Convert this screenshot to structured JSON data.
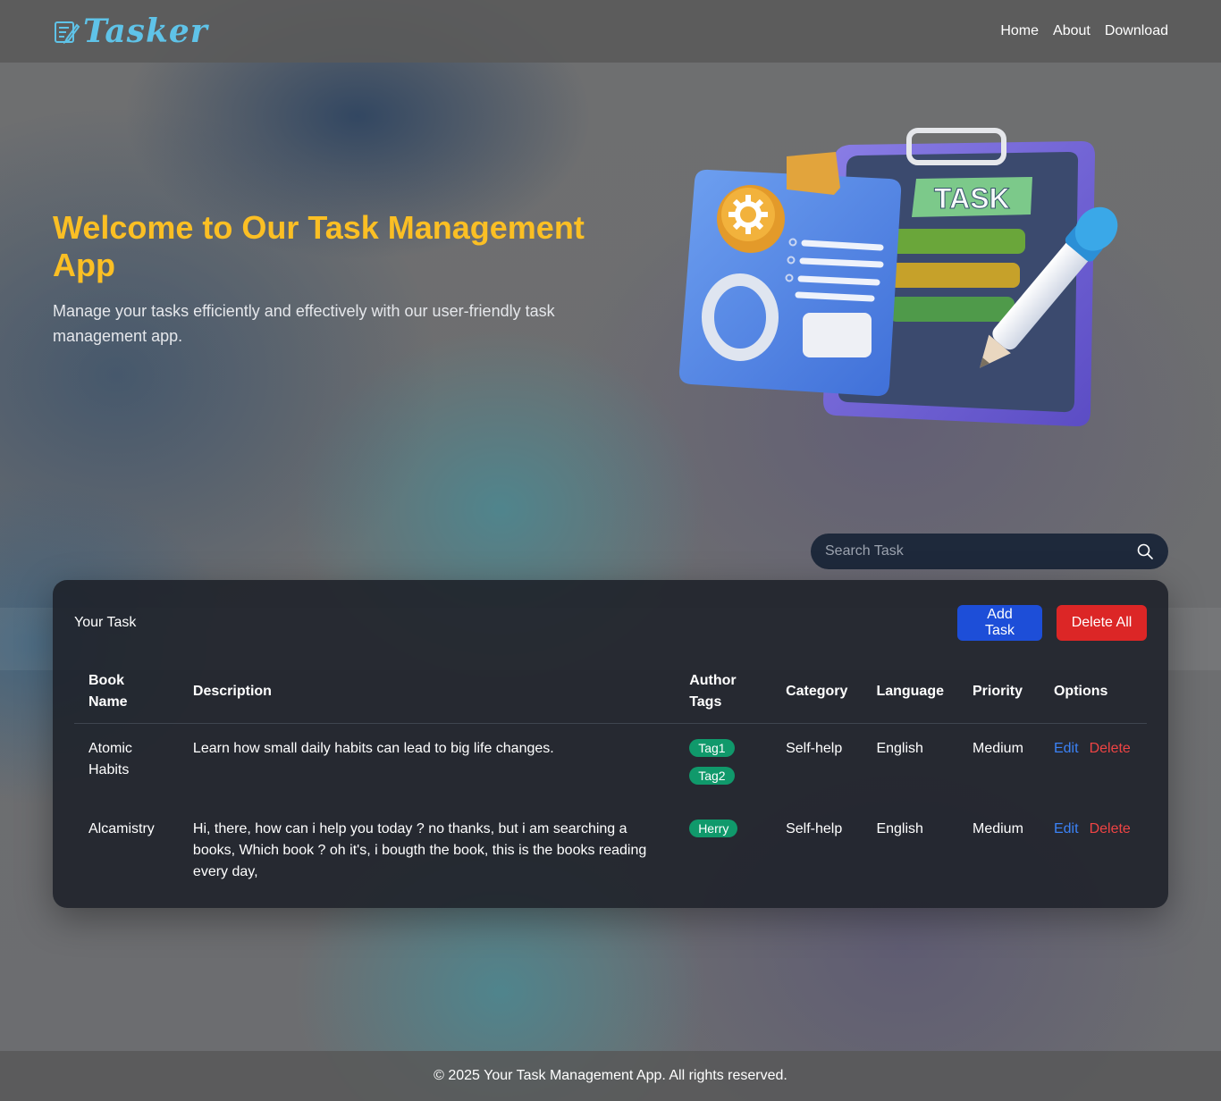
{
  "brand": {
    "name": "Tasker",
    "icon": "notepad-pen-icon"
  },
  "nav": [
    "Home",
    "About",
    "Download"
  ],
  "hero": {
    "title": "Welcome to Our Task Management App",
    "subtitle": "Manage your tasks efficiently and effectively with our user-friendly task management app.",
    "illustration_label": "TASK"
  },
  "search": {
    "placeholder": "Search Task",
    "icon": "search-icon"
  },
  "tasks": {
    "title": "Your Task",
    "add_label": "Add Task",
    "delete_all_label": "Delete All",
    "columns": [
      "Book Name",
      "Description",
      "Author Tags",
      "Category",
      "Language",
      "Priority",
      "Options"
    ],
    "rows": [
      {
        "name": "Atomic Habits",
        "description": "Learn how small daily habits can lead to big life changes.",
        "tags": [
          "Tag1",
          "Tag2"
        ],
        "category": "Self-help",
        "language": "English",
        "priority": "Medium",
        "edit": "Edit",
        "delete": "Delete"
      },
      {
        "name": "Alcamistry",
        "description": "Hi, there, how can i help you today ? no thanks, but i am searching a books, Which book ? oh it's, i bougth the book, this is the books reading every day,",
        "tags": [
          "Herry"
        ],
        "category": "Self-help",
        "language": "English",
        "priority": "Medium",
        "edit": "Edit",
        "delete": "Delete"
      }
    ]
  },
  "footer": "© 2025 Your Task Management App. All rights reserved.",
  "colors": {
    "accent_title": "#fbbf24",
    "add_button": "#1d4ed8",
    "delete_button": "#dc2626",
    "tag": "#10996b",
    "edit_link": "#3b82f6",
    "delete_link": "#ef4444"
  }
}
